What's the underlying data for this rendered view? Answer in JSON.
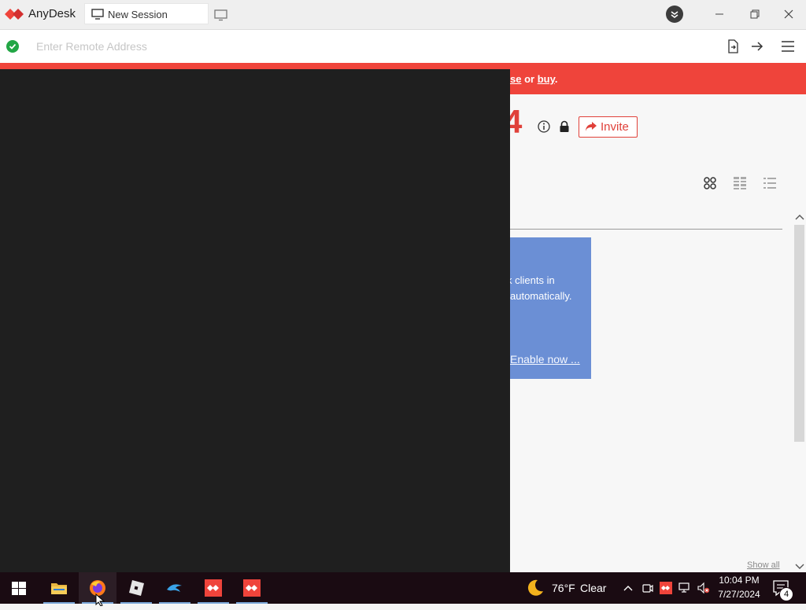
{
  "app": {
    "name": "AnyDesk"
  },
  "tab": {
    "label": "New Session"
  },
  "address_bar": {
    "placeholder": "Enter Remote Address",
    "value": ""
  },
  "banner": {
    "text_partial": "se",
    "or": " or ",
    "buy": "buy",
    "period": "."
  },
  "desk": {
    "address_digit": "4",
    "invite_label": "Invite"
  },
  "promo": {
    "line1": "k clients in",
    "line2": "automatically.",
    "link": "Enable now ..."
  },
  "show_all": "Show all",
  "taskbar": {
    "weather": {
      "temp": "76°F",
      "condition": "Clear"
    },
    "clock": {
      "time": "10:04 PM",
      "date": "7/27/2024"
    },
    "notifications": "4"
  },
  "colors": {
    "accent": "#ef443b",
    "banner": "#ef443b",
    "promo": "#6b8fd5",
    "overlay": "#1f1f1f",
    "taskbar": "#1a0b12"
  }
}
